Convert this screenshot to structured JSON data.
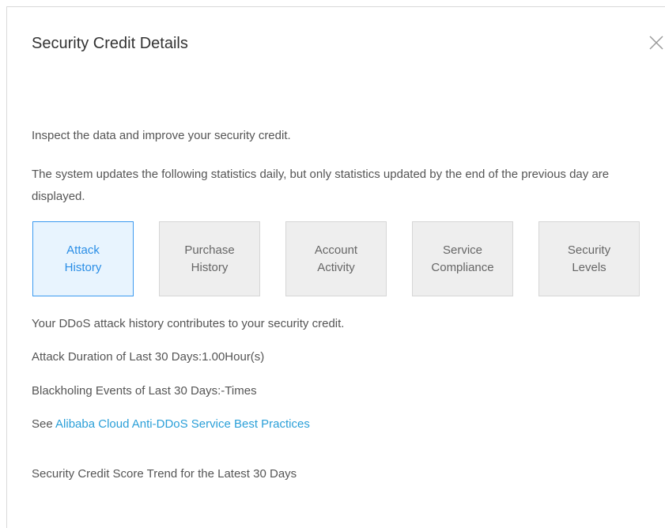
{
  "dialog": {
    "title": "Security Credit Details",
    "close_icon": "close-icon"
  },
  "intro": {
    "line1": "Inspect the data and improve your security credit.",
    "line2": "The system updates the following statistics daily, but only statistics updated by the end of the previous day are displayed."
  },
  "tabs": [
    {
      "line1": "Attack",
      "line2": "History",
      "active": true
    },
    {
      "line1": "Purchase",
      "line2": "History",
      "active": false
    },
    {
      "line1": "Account",
      "line2": "Activity",
      "active": false
    },
    {
      "line1": "Service",
      "line2": "Compliance",
      "active": false
    },
    {
      "line1": "Security",
      "line2": "Levels",
      "active": false
    }
  ],
  "details": {
    "contribution": "Your DDoS attack history contributes to your security credit.",
    "attack_duration": "Attack Duration of Last 30 Days:1.00Hour(s)",
    "blackholing": "Blackholing Events of Last 30 Days:-Times",
    "see_prefix": "See ",
    "best_practices_link": "Alibaba Cloud Anti-DDoS Service Best Practices",
    "trend_title": "Security Credit Score Trend for the Latest 30 Days"
  },
  "colors": {
    "accent": "#2a8ee6",
    "link": "#2a9fd8",
    "active_tab_bg": "#e8f4fe",
    "tab_bg": "#eeeeee"
  }
}
